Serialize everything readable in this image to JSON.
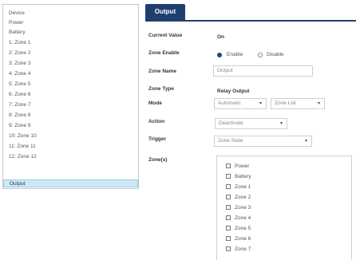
{
  "sidebar": {
    "items": [
      {
        "label": "Device"
      },
      {
        "label": "Power"
      },
      {
        "label": "Battery"
      },
      {
        "label": "1: Zone 1"
      },
      {
        "label": "2: Zone 2"
      },
      {
        "label": "3: Zone 3"
      },
      {
        "label": "4: Zone 4"
      },
      {
        "label": "5: Zone 5"
      },
      {
        "label": "6: Zone 6"
      },
      {
        "label": "7: Zone 7"
      },
      {
        "label": "8: Zone 8"
      },
      {
        "label": "9: Zone 9"
      },
      {
        "label": "10: Zone 10"
      },
      {
        "label": "11: Zone 11"
      },
      {
        "label": "12: Zone 12"
      },
      {
        "label": "Output"
      }
    ],
    "selected": "Output"
  },
  "header": {
    "tab_label": "Output",
    "accent_color": "#1f3f6e"
  },
  "form": {
    "current_value": {
      "label": "Current Value",
      "value": "On"
    },
    "zone_enable": {
      "label": "Zone Enable",
      "options": [
        "Enable",
        "Disable"
      ],
      "selected": "Enable"
    },
    "zone_name": {
      "label": "Zone Name",
      "value": "Output"
    },
    "zone_type": {
      "label": "Zone Type",
      "value": "Relay Output"
    },
    "mode": {
      "label": "Mode",
      "value1": "Automatic",
      "value2": "Zone List"
    },
    "action": {
      "label": "Action",
      "value": "Deactivate"
    },
    "trigger": {
      "label": "Trigger",
      "value": "Zone State"
    },
    "zones": {
      "label": "Zone(s)",
      "items": [
        "Power",
        "Battery",
        "Zone 1",
        "Zone 2",
        "Zone 3",
        "Zone 4",
        "Zone 5",
        "Zone 6",
        "Zone 7"
      ]
    }
  },
  "icons": {
    "caret": "▾"
  }
}
